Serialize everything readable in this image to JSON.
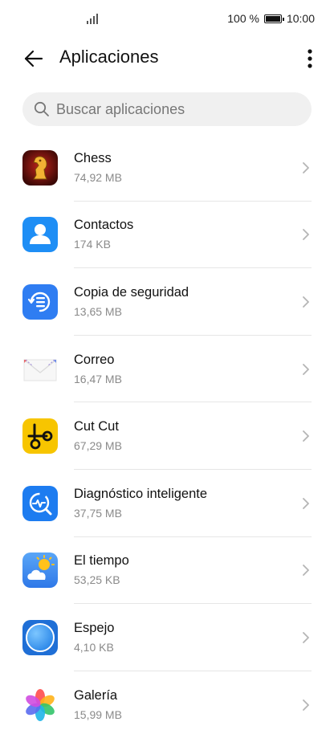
{
  "status": {
    "battery_text": "100 %",
    "time": "10:00"
  },
  "header": {
    "title": "Aplicaciones"
  },
  "search": {
    "placeholder": "Buscar aplicaciones"
  },
  "apps": [
    {
      "name": "Chess",
      "size": "74,92 MB",
      "icon": "chess-icon"
    },
    {
      "name": "Contactos",
      "size": "174 KB",
      "icon": "contacts-icon"
    },
    {
      "name": "Copia de seguridad",
      "size": "13,65 MB",
      "icon": "backup-icon"
    },
    {
      "name": "Correo",
      "size": "16,47 MB",
      "icon": "mail-icon"
    },
    {
      "name": "Cut Cut",
      "size": "67,29 MB",
      "icon": "cutcut-icon"
    },
    {
      "name": "Diagnóstico inteligente",
      "size": "37,75 MB",
      "icon": "diagnostics-icon"
    },
    {
      "name": "El tiempo",
      "size": "53,25 KB",
      "icon": "weather-icon"
    },
    {
      "name": "Espejo",
      "size": "4,10 KB",
      "icon": "mirror-icon"
    },
    {
      "name": "Galería",
      "size": "15,99 MB",
      "icon": "gallery-icon"
    }
  ],
  "colors": {
    "contacts": "#1e8ef5",
    "backup": "#2f7df2",
    "cutcut": "#f7c500",
    "diagnostics": "#1d7cf0",
    "weather": "#3b8df0",
    "mirror": "#3aa0f5"
  }
}
